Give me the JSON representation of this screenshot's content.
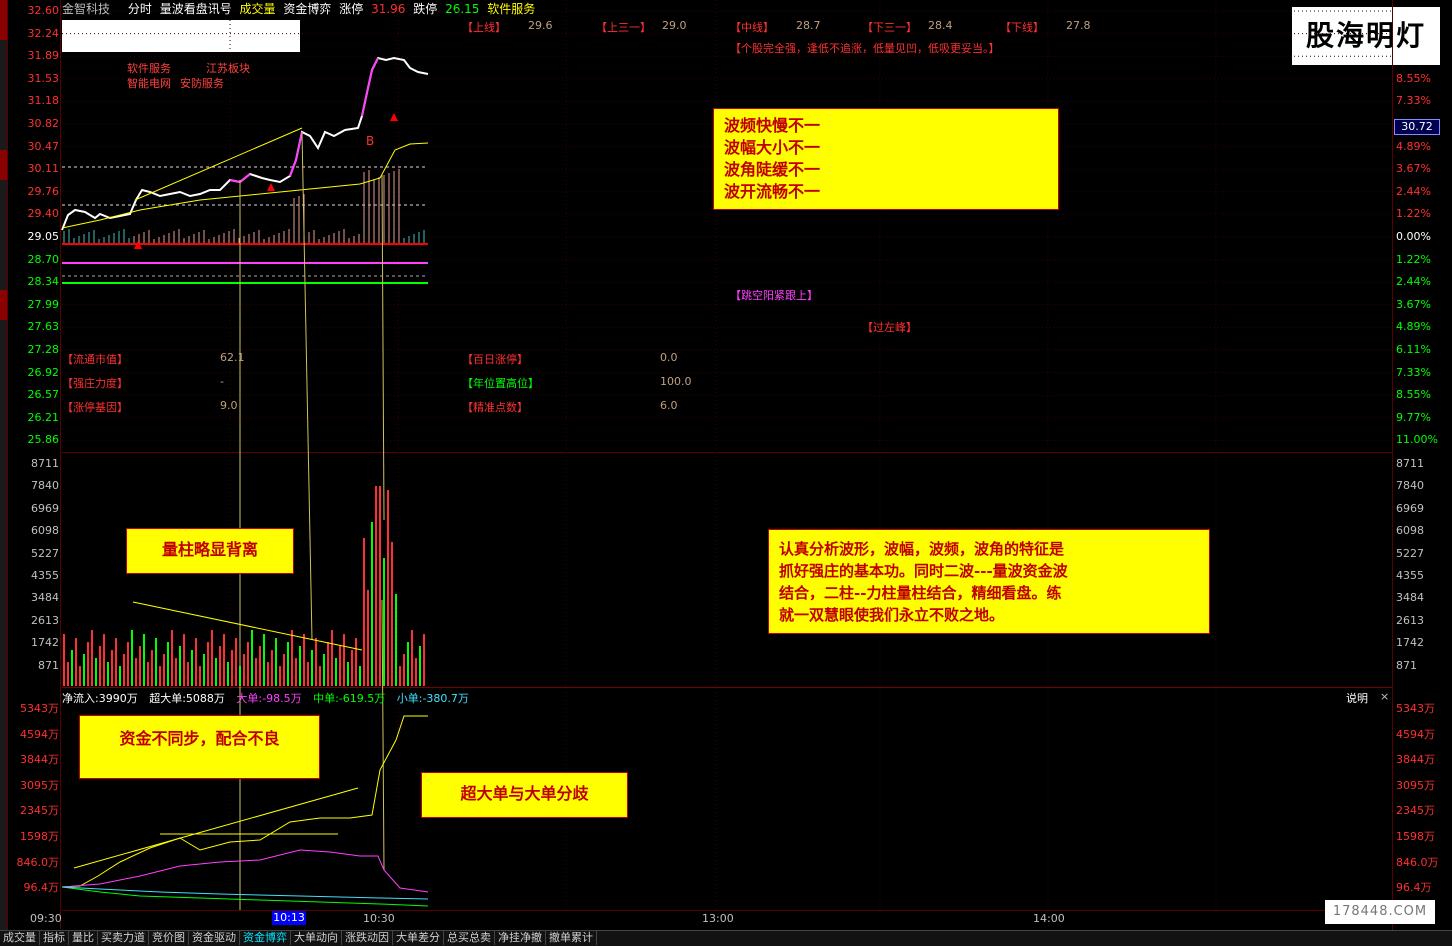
{
  "topbar": {
    "name": "金智科技",
    "mode": "分时",
    "indicator": "量波看盘讯号",
    "volume_label": "成交量",
    "fund_label": "资金博弈",
    "limit_up_label": "涨停",
    "limit_up_value": "31.96",
    "limit_down_label": "跌停",
    "limit_down_value": "26.15",
    "sector": "软件服务"
  },
  "price_axis_left": [
    "32.60",
    "32.24",
    "31.89",
    "31.53",
    "31.18",
    "30.82",
    "30.47",
    "30.11",
    "29.76",
    "29.40",
    "29.05",
    "28.70",
    "28.34",
    "27.99",
    "27.63",
    "27.28",
    "26.92",
    "26.57",
    "26.21",
    "25.86"
  ],
  "pct_axis_right": [
    "",
    "",
    "",
    "8.55%",
    "7.33%",
    "",
    "4.89%",
    "3.67%",
    "2.44%",
    "1.22%",
    "0.00%",
    "1.22%",
    "2.44%",
    "3.67%",
    "4.89%",
    "6.11%",
    "7.33%",
    "8.55%",
    "9.77%",
    "11.00%"
  ],
  "vol_axis": [
    "8711",
    "7840",
    "6969",
    "6098",
    "5227",
    "4355",
    "3484",
    "2613",
    "1742",
    "871"
  ],
  "fund_axis": [
    "5343万",
    "4594万",
    "3844万",
    "3095万",
    "2345万",
    "1598万",
    "846.0万",
    "96.4万"
  ],
  "cursor_price": "30.72",
  "board_tags": {
    "t1": "软件服务",
    "t2": "江苏板块",
    "t3": "智能电网",
    "t4": "安防服务"
  },
  "marker_b": "B",
  "levels": [
    {
      "label": "【上线】",
      "value": "29.6"
    },
    {
      "label": "【上三一】",
      "value": "29.0"
    },
    {
      "label": "【中线】",
      "value": "28.7"
    },
    {
      "label": "【下三一】",
      "value": "28.4"
    },
    {
      "label": "【下线】",
      "value": "27.8"
    }
  ],
  "signal_text": "【个股完全强，逢低不追涨，低量见凹，低吸更妥当。】",
  "tag_gap": "【跳空阳紧跟上】",
  "tag_left_peak": "【过左峰】",
  "stats_left": [
    {
      "label": "【流通市值】",
      "value": "62.1"
    },
    {
      "label": "【强庄力度】",
      "value": "-"
    },
    {
      "label": "【涨停基因】",
      "value": "9.0"
    }
  ],
  "stats_right": [
    {
      "label": "【百日涨停】",
      "value": "0.0"
    },
    {
      "label": "【年位置高位】",
      "value": "100.0"
    },
    {
      "label": "【精准点数】",
      "value": "6.0"
    }
  ],
  "fund_header": {
    "net": "净流入:3990万",
    "super": "超大单:5088万",
    "large": "大单:-98.5万",
    "medium": "中单:-619.5万",
    "small": "小单:-380.7万",
    "explain": "说明",
    "close": "×"
  },
  "notes": {
    "wave": [
      "波频快慢不一",
      "波幅大小不一",
      "波角陡缓不一",
      "波开流畅不一"
    ],
    "divergence": "量柱略显背离",
    "analysis": [
      "认真分析波形，波幅，波频，波角的特征是",
      "抓好强庄的基本功。同时二波---量波资金波",
      "结合，二柱--力柱量柱结合，精细看盘。练",
      "就一双慧眼使我们永立不败之地。"
    ],
    "fund_async": "资金不同步，配合不良",
    "super_large": "超大单与大单分歧"
  },
  "time_axis": {
    "t1": "09:30",
    "t2": "10:13",
    "t3": "10:30",
    "t4": "13:00",
    "t5": "14:00"
  },
  "tabs": [
    "成交量",
    "指标",
    "量比",
    "买卖力道",
    "竞价图",
    "资金驱动",
    "资金博弈",
    "大单动向",
    "涨跌动因",
    "大单差分",
    "总买总卖",
    "净挂净撤",
    "撤单累计"
  ],
  "active_tab": 6,
  "logo_text": "股海明灯",
  "watermark_text": "178448.COM",
  "colors": {
    "up": "#ff3030",
    "down": "#00ff00",
    "price": "#ffffff",
    "avg": "#ffff00",
    "magenta": "#ff40ff",
    "note_bg": "#ffff00"
  }
}
